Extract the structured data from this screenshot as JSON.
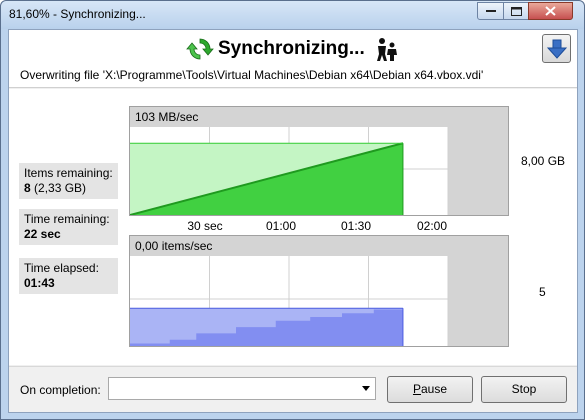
{
  "window": {
    "title": "81,60% - Synchronizing..."
  },
  "header": {
    "heading": "Synchronizing...",
    "status": "Overwriting file 'X:\\Programme\\Tools\\Virtual Machines\\Debian x64\\Debian x64.vbox.vdi'"
  },
  "stats": {
    "items_remaining_label": "Items remaining:",
    "items_remaining_value": "8",
    "items_remaining_size": "(2,33 GB)",
    "time_remaining_label": "Time remaining:",
    "time_remaining_value": "22 sec",
    "time_elapsed_label": "Time elapsed:",
    "time_elapsed_value": "01:43"
  },
  "graphs": {
    "data_rate": "103 MB/sec",
    "item_rate": "0,00 items/sec",
    "data_total": "8,00 GB",
    "items_total": "5",
    "time_ticks": [
      "30 sec",
      "01:00",
      "01:30",
      "02:00"
    ]
  },
  "chart_data": [
    {
      "type": "area",
      "title": "103 MB/sec",
      "xlabel": "",
      "ylabel": "",
      "x_ticks": [
        "30 sec",
        "01:00",
        "01:30",
        "02:00"
      ],
      "x_seconds": [
        0,
        103
      ],
      "y_fraction": [
        0,
        0.816
      ],
      "y_max_label": "8,00 GB",
      "color": "#33cc33"
    },
    {
      "type": "area",
      "title": "0,00 items/sec",
      "xlabel": "",
      "ylabel": "",
      "x_seconds": [
        0,
        15,
        25,
        40,
        55,
        68,
        80,
        92,
        103
      ],
      "y_items": [
        0.2,
        0.5,
        1.0,
        1.5,
        2.0,
        2.3,
        2.6,
        2.9,
        3.0
      ],
      "y_max_label": "5",
      "color": "#5566ee"
    }
  ],
  "footer": {
    "completion_label": "On completion:",
    "completion_value": "",
    "pause_label": "Pause",
    "stop_label": "Stop"
  },
  "colors": {
    "bytes_fill": "#c4f5c4",
    "bytes_line": "#33cc33",
    "items_fill": "#aab4f5",
    "items_line": "#4b5ce0",
    "grid_bg": "#d4d4d4"
  }
}
